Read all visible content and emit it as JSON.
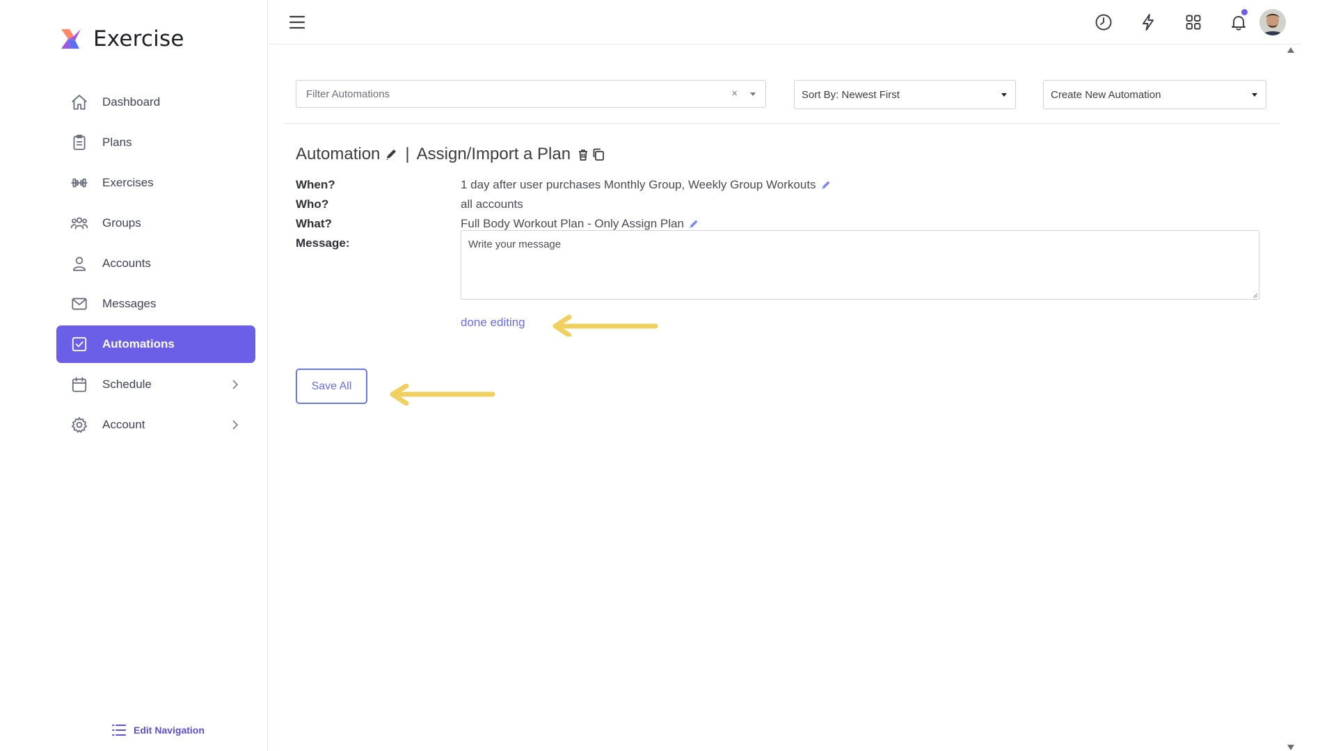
{
  "sidebar": {
    "brand": "Exercise",
    "items": [
      {
        "label": "Dashboard",
        "icon": "home-icon"
      },
      {
        "label": "Plans",
        "icon": "clipboard-icon"
      },
      {
        "label": "Exercises",
        "icon": "dumbbell-icon"
      },
      {
        "label": "Groups",
        "icon": "users-icon"
      },
      {
        "label": "Accounts",
        "icon": "user-icon"
      },
      {
        "label": "Messages",
        "icon": "mail-icon"
      },
      {
        "label": "Automations",
        "icon": "check-square-icon",
        "active": true
      },
      {
        "label": "Schedule",
        "icon": "calendar-icon",
        "expandable": true
      },
      {
        "label": "Account",
        "icon": "gear-icon",
        "expandable": true
      }
    ],
    "edit_navigation": "Edit Navigation"
  },
  "topbar": {
    "icons": [
      "hamburger-icon",
      "clock-icon",
      "lightning-icon",
      "grid-icon",
      "bell-icon",
      "avatar"
    ],
    "notification_dot_color": "#6a5fe6"
  },
  "filters": {
    "filter_placeholder": "Filter Automations",
    "clear_symbol": "×",
    "sort_label": "Sort By: Newest First",
    "create_label": "Create New Automation"
  },
  "automation": {
    "title_prefix": "Automation",
    "separator": "|",
    "name": "Assign/Import a Plan",
    "when_label": "When?",
    "when_value": "1 day after user purchases Monthly Group, Weekly Group Workouts",
    "who_label": "Who?",
    "who_value": "all accounts",
    "what_label": "What?",
    "what_value": "Full Body Workout Plan - Only Assign Plan",
    "message_label": "Message:",
    "message_placeholder": "Write your message",
    "done_editing": "done editing",
    "save_all": "Save All"
  },
  "colors": {
    "accent": "#6a5fe6",
    "link": "#6a6ce8",
    "annotation_arrow": "#f0d060"
  }
}
